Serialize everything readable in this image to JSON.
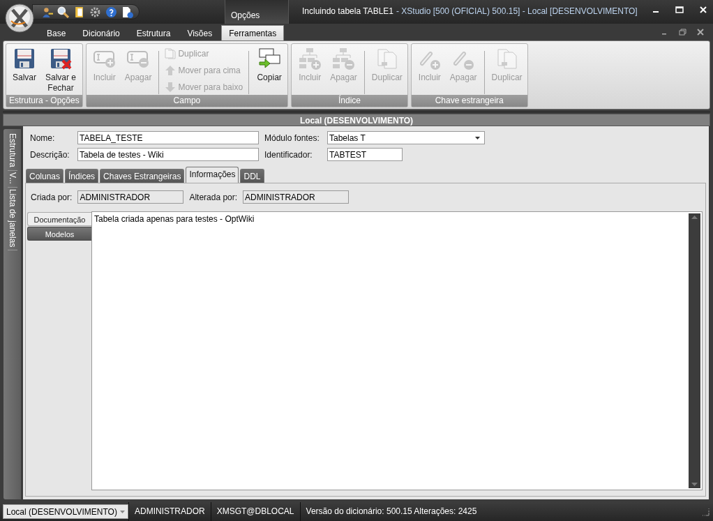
{
  "window": {
    "title_document": "Incluindo tabela TABLE1",
    "title_app": "- XStudio [500 (OFICIAL) 500.15] - Local [DESENVOLVIMENTO]"
  },
  "contextual_tab": {
    "label": "Opções"
  },
  "ribbon_tabs": [
    {
      "label": "Base",
      "selected": false
    },
    {
      "label": "Dicionário",
      "selected": false
    },
    {
      "label": "Estrutura",
      "selected": false
    },
    {
      "label": "Visões",
      "selected": false
    },
    {
      "label": "Ferramentas",
      "selected": true
    }
  ],
  "ribbon_groups": [
    {
      "label": "Estrutura - Opções",
      "items": [
        {
          "kind": "large",
          "label": "Salvar",
          "disabled": false
        },
        {
          "kind": "large",
          "label": "Salvar e Fechar",
          "disabled": false
        }
      ]
    },
    {
      "label": "Campo",
      "items": [
        {
          "kind": "large",
          "label": "Incluir",
          "disabled": true
        },
        {
          "kind": "large",
          "label": "Apagar",
          "disabled": true
        },
        {
          "kind": "separator"
        },
        {
          "kind": "stack",
          "children": [
            {
              "label": "Duplicar",
              "disabled": true
            },
            {
              "label": "Mover para cima",
              "disabled": true
            },
            {
              "label": "Mover para baixo",
              "disabled": true
            }
          ]
        },
        {
          "kind": "separator"
        },
        {
          "kind": "large",
          "label": "Copiar",
          "disabled": false
        }
      ]
    },
    {
      "label": "Índice",
      "items": [
        {
          "kind": "large",
          "label": "Incluir",
          "disabled": true
        },
        {
          "kind": "large",
          "label": "Apagar",
          "disabled": true
        },
        {
          "kind": "separator"
        },
        {
          "kind": "large",
          "label": "Duplicar",
          "disabled": true
        }
      ]
    },
    {
      "label": "Chave estrangeira",
      "items": [
        {
          "kind": "large",
          "label": "Incluir",
          "disabled": true
        },
        {
          "kind": "large",
          "label": "Apagar",
          "disabled": true
        },
        {
          "kind": "separator"
        },
        {
          "kind": "large",
          "label": "Duplicar",
          "disabled": true
        }
      ]
    }
  ],
  "document": {
    "title": "Local (DESENVOLVIMENTO)"
  },
  "side_panel_tabs": [
    {
      "label": "Estrutura"
    },
    {
      "label": "V..."
    },
    {
      "label": "Lista de janelas"
    }
  ],
  "form": {
    "name": {
      "label": "Nome:",
      "value": "TABELA_TESTE"
    },
    "description": {
      "label": "Descrição:",
      "value": "Tabela de testes - Wiki"
    },
    "module": {
      "label": "Módulo fontes:",
      "value": "Tabelas T"
    },
    "identifier": {
      "label": "Identificador:",
      "value": "TABTEST"
    }
  },
  "tabs": [
    {
      "label": "Colunas",
      "selected": false
    },
    {
      "label": "Índices",
      "selected": false
    },
    {
      "label": "Chaves Estrangeiras",
      "selected": false
    },
    {
      "label": "Informações",
      "selected": true
    },
    {
      "label": "DDL",
      "selected": false
    }
  ],
  "info": {
    "created_by": {
      "label": "Criada por:",
      "value": "ADMINISTRADOR"
    },
    "changed_by": {
      "label": "Alterada por:",
      "value": "ADMINISTRADOR"
    }
  },
  "doc_tabs": [
    {
      "label": "Documentação",
      "selected": true
    },
    {
      "label": "Modelos",
      "selected": false
    }
  ],
  "documentation_text": "Tabela criada apenas para testes - OptWiki",
  "status_bar": {
    "connection": "Local (DESENVOLVIMENTO)",
    "user": "ADMINISTRADOR",
    "database": "XMSGT@DBLOCAL",
    "info": "Versão do dicionário: 500.15 Alterações: 2425"
  }
}
